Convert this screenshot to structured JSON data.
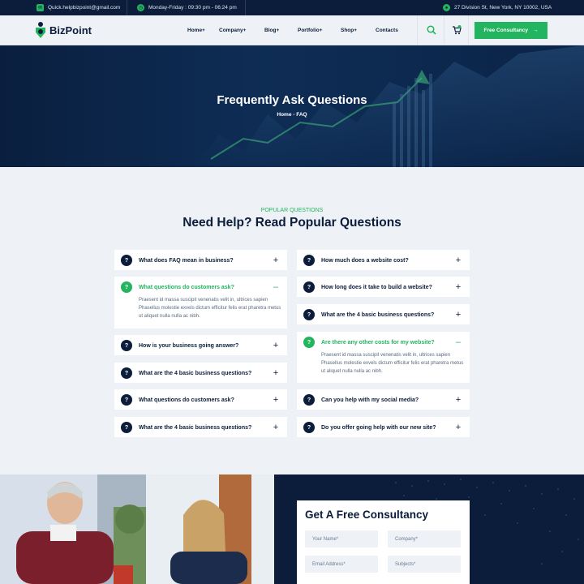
{
  "topbar": {
    "email": "Quick.helpbizpoint@gmail.com",
    "hours": "Monday-Friday : 09:30 pm - 06:24 pm",
    "address": "27 Division St, New York, NY 10002, USA"
  },
  "header": {
    "logo": "BizPoint",
    "nav": [
      {
        "label": "Home+"
      },
      {
        "label": "Company+"
      },
      {
        "label": "Blog+"
      },
      {
        "label": "Portfolio+"
      },
      {
        "label": "Shop+"
      },
      {
        "label": "Contacts"
      }
    ],
    "cta": "Free Consultancy"
  },
  "hero": {
    "title": "Frequently Ask Questions",
    "breadcrumb": "Home - FAQ"
  },
  "faq_section": {
    "eyebrow": "POPULAR QUESTIONS",
    "title": "Need Help? Read Popular Questions",
    "left": [
      {
        "q": "What does FAQ mean in business?",
        "state": "closed"
      },
      {
        "q": "What questions do customers ask?",
        "state": "open",
        "a": "Praesent id massa suscipit venenatis velit in, ultrices sapien Phasellus molestie exvels dictum efficitur felis erat pharetra metus ut aliquet nulla nulla ac nibh."
      },
      {
        "q": "How is your business going answer?",
        "state": "closed"
      },
      {
        "q": "What are the 4 basic business questions?",
        "state": "closed"
      },
      {
        "q": "What questions do customers ask?",
        "state": "closed"
      },
      {
        "q": "What are the 4 basic business questions?",
        "state": "closed"
      }
    ],
    "right": [
      {
        "q": "How much does a website cost?",
        "state": "closed"
      },
      {
        "q": "How long does it take to build a website?",
        "state": "closed"
      },
      {
        "q": "What are the 4 basic business questions?",
        "state": "closed"
      },
      {
        "q": "Are there any other costs for my website?",
        "state": "open",
        "a": "Praesent id massa suscipit venenatis velit in, ultrices sapien Phasellus molestie exvels dictum efficitur felis erat pharetra metus ut aliquet nulla nulla ac nibh."
      },
      {
        "q": "Can you help with my social media?",
        "state": "closed"
      },
      {
        "q": "Do you offer going help with our new site?",
        "state": "closed"
      }
    ]
  },
  "consultancy": {
    "title": "Get A Free Consultancy",
    "fields": {
      "name": "Your Name*",
      "company": "Company*",
      "email": "Email Address*",
      "subject": "Subjects*"
    }
  },
  "colors": {
    "brand_green": "#23b45f",
    "navy": "#0b1d3a",
    "page_bg": "#eef2f7"
  }
}
